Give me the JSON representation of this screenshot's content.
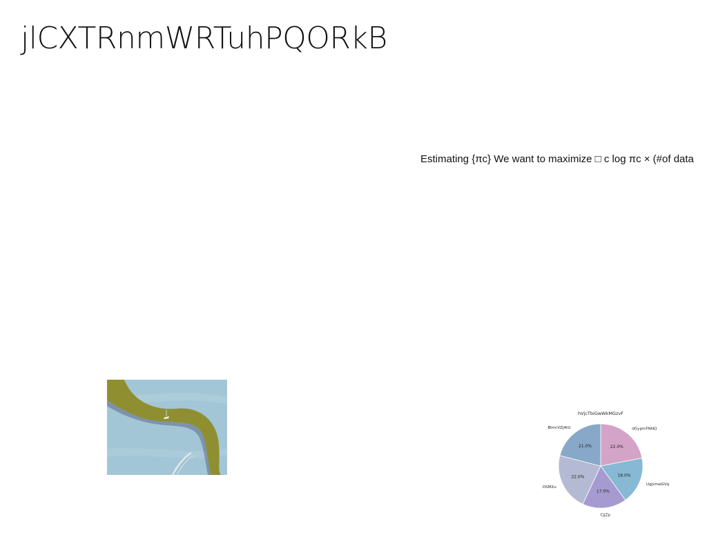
{
  "slide": {
    "title": "jlCXTRnmWRTuhPQORkB",
    "formula_text": "Estimating {πc} We want to maximize □ c log πc × (#of data"
  },
  "colors": {
    "background": "#ffffff",
    "text": "#111111",
    "photo_water": "#9fc4d6",
    "photo_land": "#8f8f32"
  },
  "chart_data": {
    "type": "pie",
    "title": "hVjcTbiGwWkMGzvF",
    "categories": [
      "dGypmFNNQ",
      "UgjvmeGVq",
      "CjjZp",
      "OSMXu",
      "BlmcVZjAtU"
    ],
    "values": [
      22.0,
      18.0,
      17.0,
      22.0,
      21.0
    ],
    "value_labels": [
      "22.0%",
      "18.0%",
      "17.0%",
      "22.0%",
      "21.0%"
    ],
    "colors": [
      "#d3a4c7",
      "#88b9d4",
      "#a69bd0",
      "#b4bad3",
      "#87a8c9"
    ],
    "start": "top",
    "direction": "clockwise"
  }
}
